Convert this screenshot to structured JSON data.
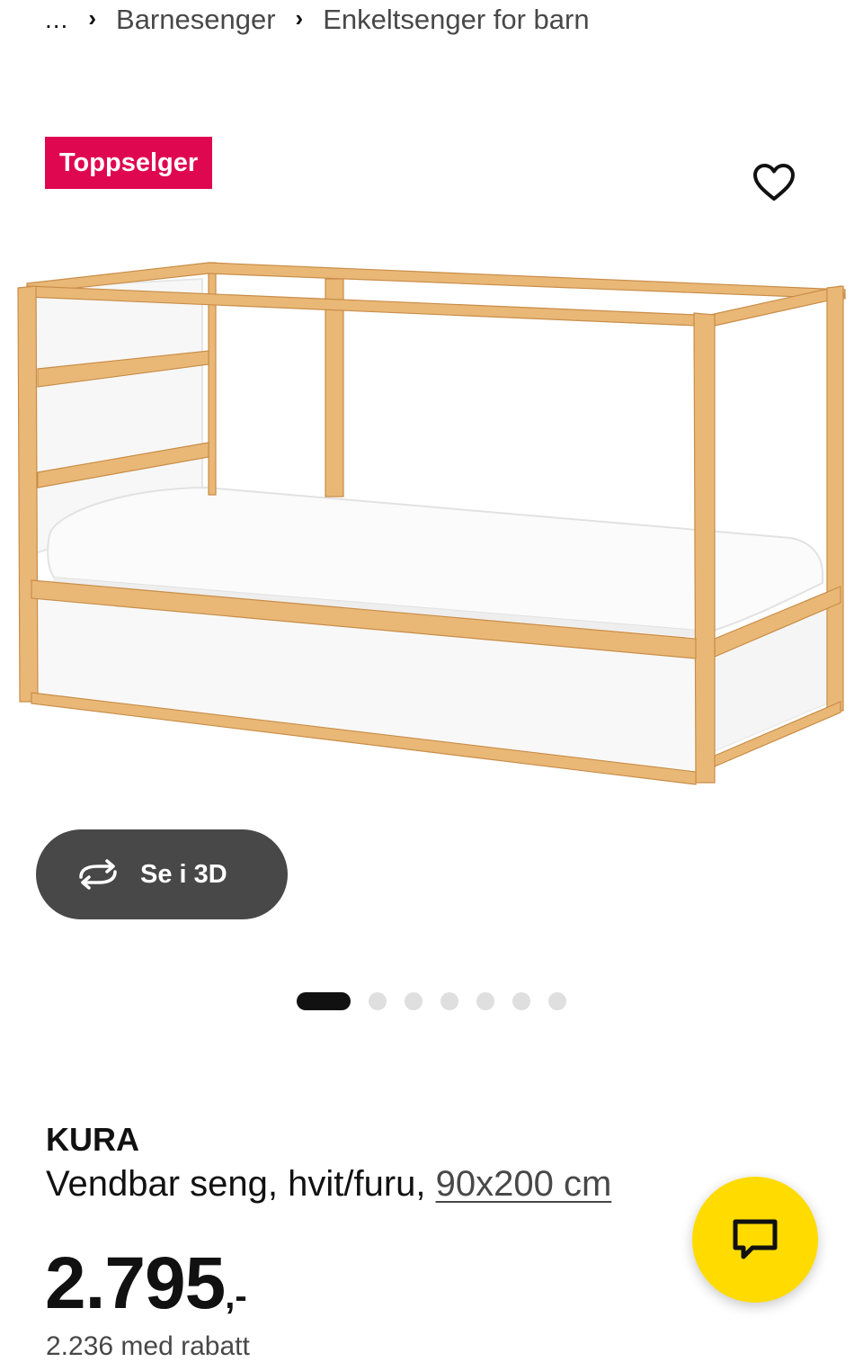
{
  "breadcrumb": {
    "ellipsis": "...",
    "items": [
      "Barnesenger",
      "Enkeltsenger for barn"
    ]
  },
  "badge": {
    "label": "Toppselger",
    "color": "#e00751"
  },
  "favorite": {
    "icon": "heart-outline-icon"
  },
  "view3d": {
    "label": "Se i 3D",
    "icon": "rotate-3d-icon"
  },
  "carousel": {
    "total": 7,
    "active_index": 0
  },
  "product": {
    "name": "KURA",
    "description": "Vendbar seng, hvit/furu,",
    "size_link": "90x200 cm",
    "price_amount": "2.795",
    "price_suffix": ",-",
    "sub_price_partial": "2.236 med rabatt"
  },
  "chat": {
    "icon": "chat-bubble-icon",
    "color": "#ffdb00"
  }
}
